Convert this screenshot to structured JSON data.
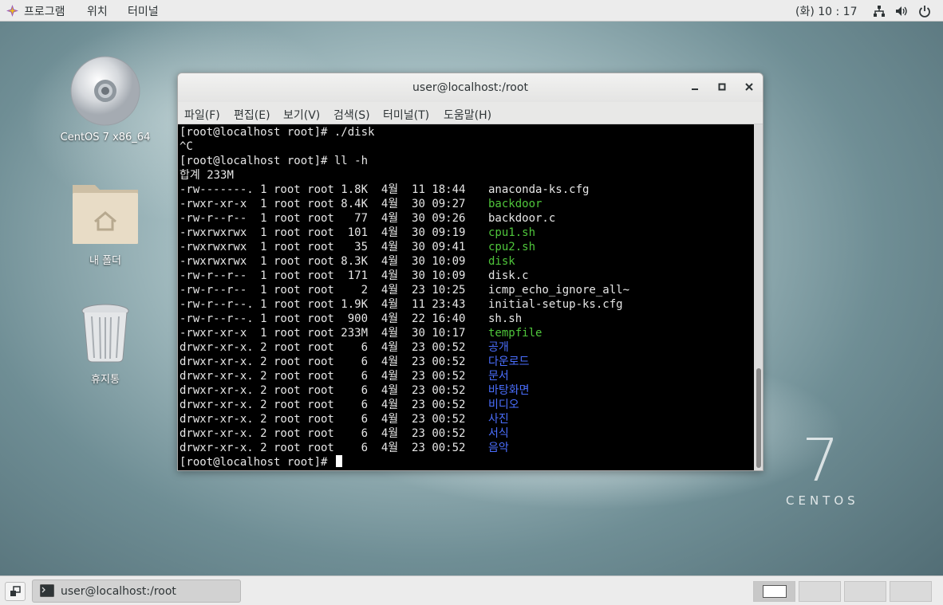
{
  "top_panel": {
    "menus": [
      "프로그램",
      "위치",
      "터미널"
    ],
    "clock": "(화) 10 : 17",
    "icons": [
      "network-icon",
      "volume-icon",
      "power-icon"
    ]
  },
  "desktop": {
    "icons": [
      {
        "label": "CentOS 7 x86_64",
        "icon": "disc-icon"
      },
      {
        "label": "내 폴더",
        "icon": "home-folder-icon"
      },
      {
        "label": "휴지통",
        "icon": "trash-icon"
      }
    ],
    "brand_number": "7",
    "brand_word": "CENTOS"
  },
  "window": {
    "title": "user@localhost:/root",
    "buttons": [
      "minimize",
      "maximize",
      "close"
    ],
    "menus": [
      "파일(F)",
      "편집(E)",
      "보기(V)",
      "검색(S)",
      "터미널(T)",
      "도움말(H)"
    ]
  },
  "terminal": {
    "lines": [
      {
        "text": "[root@localhost root]# ./disk"
      },
      {
        "text": "^C"
      },
      {
        "text": "[root@localhost root]# ll -h"
      },
      {
        "text": "합계 233M"
      },
      {
        "text": "-rw-------. 1 root root 1.8K  4월  11 18:44 ",
        "name": "anaconda-ks.cfg",
        "kind": "plain"
      },
      {
        "text": "-rwxr-xr-x  1 root root 8.4K  4월  30 09:27 ",
        "name": "backdoor",
        "kind": "exec"
      },
      {
        "text": "-rw-r--r--  1 root root   77  4월  30 09:26 ",
        "name": "backdoor.c",
        "kind": "plain"
      },
      {
        "text": "-rwxrwxrwx  1 root root  101  4월  30 09:19 ",
        "name": "cpu1.sh",
        "kind": "exec"
      },
      {
        "text": "-rwxrwxrwx  1 root root   35  4월  30 09:41 ",
        "name": "cpu2.sh",
        "kind": "exec"
      },
      {
        "text": "-rwxrwxrwx  1 root root 8.3K  4월  30 10:09 ",
        "name": "disk",
        "kind": "exec"
      },
      {
        "text": "-rw-r--r--  1 root root  171  4월  30 10:09 ",
        "name": "disk.c",
        "kind": "plain"
      },
      {
        "text": "-rw-r--r--  1 root root    2  4월  23 10:25 ",
        "name": "icmp_echo_ignore_all~",
        "kind": "plain"
      },
      {
        "text": "-rw-r--r--. 1 root root 1.9K  4월  11 23:43 ",
        "name": "initial-setup-ks.cfg",
        "kind": "plain"
      },
      {
        "text": "-rw-r--r--. 1 root root  900  4월  22 16:40 ",
        "name": "sh.sh",
        "kind": "plain"
      },
      {
        "text": "-rwxr-xr-x  1 root root 233M  4월  30 10:17 ",
        "name": "tempfile",
        "kind": "exec"
      },
      {
        "text": "drwxr-xr-x. 2 root root    6  4월  23 00:52 ",
        "name": "공개",
        "kind": "dir"
      },
      {
        "text": "drwxr-xr-x. 2 root root    6  4월  23 00:52 ",
        "name": "다운로드",
        "kind": "dir"
      },
      {
        "text": "drwxr-xr-x. 2 root root    6  4월  23 00:52 ",
        "name": "문서",
        "kind": "dir"
      },
      {
        "text": "drwxr-xr-x. 2 root root    6  4월  23 00:52 ",
        "name": "바탕화면",
        "kind": "dir"
      },
      {
        "text": "drwxr-xr-x. 2 root root    6  4월  23 00:52 ",
        "name": "비디오",
        "kind": "dir"
      },
      {
        "text": "drwxr-xr-x. 2 root root    6  4월  23 00:52 ",
        "name": "사진",
        "kind": "dir"
      },
      {
        "text": "drwxr-xr-x. 2 root root    6  4월  23 00:52 ",
        "name": "서식",
        "kind": "dir"
      },
      {
        "text": "drwxr-xr-x. 2 root root    6  4월  23 00:52 ",
        "name": "음악",
        "kind": "dir"
      },
      {
        "text": "[root@localhost root]# ",
        "cursor": true
      }
    ],
    "colors": {
      "exec": "#4fc63b",
      "dir": "#4b6fff",
      "text": "#e6e6e6",
      "background": "#000000"
    }
  },
  "taskbar": {
    "task_label": "user@localhost:/root",
    "workspaces": 4
  }
}
